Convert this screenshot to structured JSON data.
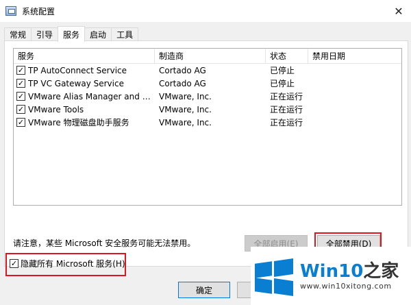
{
  "window": {
    "title": "系统配置",
    "close_glyph": "✕"
  },
  "tabs": [
    {
      "label": "常规",
      "active": false
    },
    {
      "label": "引导",
      "active": false
    },
    {
      "label": "服务",
      "active": true
    },
    {
      "label": "启动",
      "active": false
    },
    {
      "label": "工具",
      "active": false
    }
  ],
  "services": {
    "columns": [
      "服务",
      "制造商",
      "状态",
      "禁用日期"
    ],
    "rows": [
      {
        "checked": true,
        "name": "TP AutoConnect Service",
        "vendor": "Cortado AG",
        "status": "已停止",
        "disabled_date": ""
      },
      {
        "checked": true,
        "name": "TP VC Gateway Service",
        "vendor": "Cortado AG",
        "status": "已停止",
        "disabled_date": ""
      },
      {
        "checked": true,
        "name": "VMware Alias Manager and Tick...",
        "vendor": "VMware, Inc.",
        "status": "正在运行",
        "disabled_date": ""
      },
      {
        "checked": true,
        "name": "VMware Tools",
        "vendor": "VMware, Inc.",
        "status": "正在运行",
        "disabled_date": ""
      },
      {
        "checked": true,
        "name": "VMware 物理磁盘助手服务",
        "vendor": "VMware, Inc.",
        "status": "正在运行",
        "disabled_date": ""
      }
    ]
  },
  "note": "请注意，某些 Microsoft 安全服务可能无法禁用。",
  "buttons": {
    "enable_all": "全部启用(E)",
    "disable_all": "全部禁用(D)",
    "ok": "确定",
    "cancel": ""
  },
  "hide_ms": {
    "checked": true,
    "label": "隐藏所有 Microsoft 服务(H)"
  },
  "watermark": {
    "brand_prefix": "Win10",
    "brand_suffix": "之家",
    "url": "www.win10xitong.com"
  },
  "colors": {
    "highlight": "#e0141e",
    "brand": "#0a7fd1"
  }
}
